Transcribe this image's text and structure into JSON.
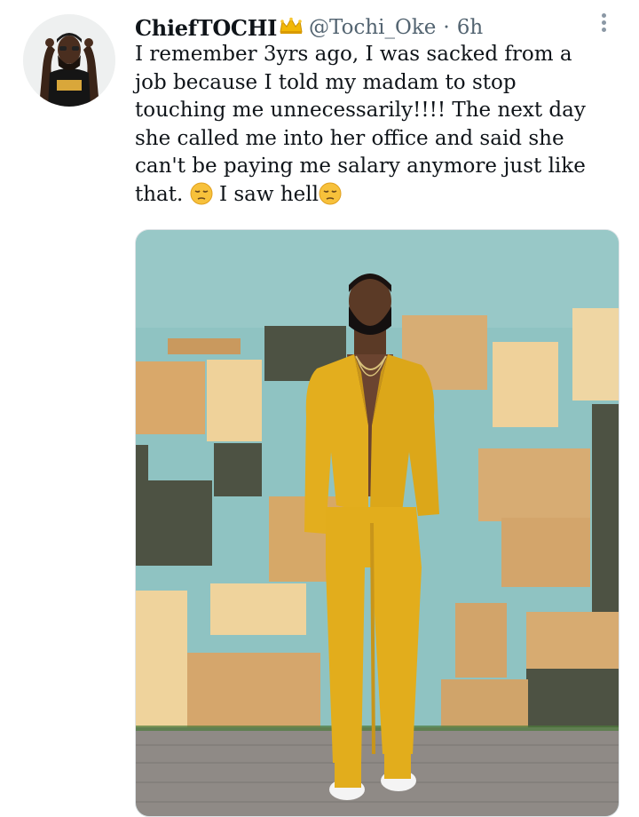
{
  "tweet": {
    "display_name": "ChiefTOCHI",
    "handle": "@Tochi_Oke",
    "separator": "·",
    "time": "6h",
    "text_lines": [
      "I remember 3yrs ago, I was sacked from a",
      "job because I told my madam to stop",
      "touching me unnecessarily!!!! The next day",
      "she called me into her office and said she",
      "can't be paying me salary anymore just like",
      "that.",
      "I saw hell"
    ],
    "icons": {
      "name_badge": "crown-icon",
      "emoji": "pensive-face-emoji",
      "menu": "more-options-icon"
    },
    "colors": {
      "suit": "#e6b21e",
      "background_wall": "#8fc3c2",
      "handle_gray": "#536471"
    }
  }
}
